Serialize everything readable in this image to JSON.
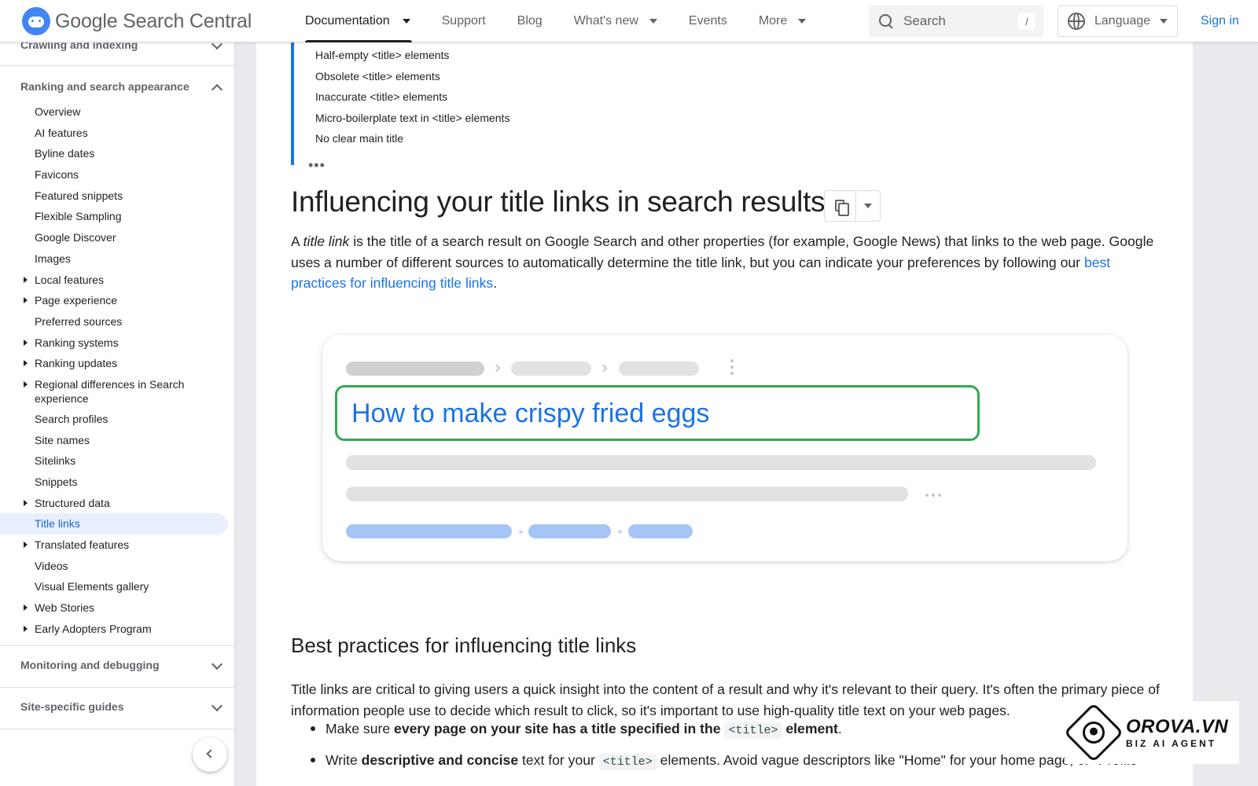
{
  "header": {
    "logo_google": "Google",
    "logo_product": "Search Central",
    "nav": [
      {
        "label": "Documentation"
      },
      {
        "label": "Support"
      },
      {
        "label": "Blog"
      },
      {
        "label": "What's new"
      },
      {
        "label": "Events"
      },
      {
        "label": "More"
      }
    ],
    "search_placeholder": "Search",
    "search_shortcut": "/",
    "language_label": "Language",
    "signin_label": "Sign in"
  },
  "sidebar": {
    "section_top": "Crawling and indexing",
    "section_ranking": "Ranking and search appearance",
    "items": [
      {
        "label": "Overview"
      },
      {
        "label": "AI features"
      },
      {
        "label": "Byline dates"
      },
      {
        "label": "Favicons"
      },
      {
        "label": "Featured snippets"
      },
      {
        "label": "Flexible Sampling"
      },
      {
        "label": "Google Discover"
      },
      {
        "label": "Images"
      },
      {
        "label": "Local features"
      },
      {
        "label": "Page experience"
      },
      {
        "label": "Preferred sources"
      },
      {
        "label": "Ranking systems"
      },
      {
        "label": "Ranking updates"
      },
      {
        "label": "Regional differences in Search experience"
      },
      {
        "label": "Search profiles"
      },
      {
        "label": "Site names"
      },
      {
        "label": "Sitelinks"
      },
      {
        "label": "Snippets"
      },
      {
        "label": "Structured data"
      },
      {
        "label": "Title links"
      },
      {
        "label": "Translated features"
      },
      {
        "label": "Videos"
      },
      {
        "label": "Visual Elements gallery"
      },
      {
        "label": "Web Stories"
      },
      {
        "label": "Early Adopters Program"
      }
    ],
    "section_monitoring": "Monitoring and debugging",
    "section_site": "Site-specific guides"
  },
  "toc": {
    "items": [
      "Half-empty <title> elements",
      "Obsolete <title> elements",
      "Inaccurate <title> elements",
      "Micro-boilerplate text in <title> elements",
      "No clear main title"
    ],
    "more": "•••"
  },
  "main": {
    "h1": "Influencing your title links in search results",
    "intro_a": "A ",
    "intro_em": "title link",
    "intro_b": " is the title of a search result on Google Search and other properties (for example, Google News) that links to the web page. Google uses a number of different sources to automatically determine the title link, but you can indicate your preferences by following our ",
    "intro_link": "best practices for influencing title links",
    "intro_end": ".",
    "illustration_title": "How to make crispy fried eggs",
    "h2": "Best practices for influencing title links",
    "para2": "Title links are critical to giving users a quick insight into the content of a result and why it's relevant to their query. It's often the primary piece of information people use to decide which result to click, so it's important to use high-quality title text on your web pages.",
    "bullet1_a": "Make sure ",
    "bullet1_b": "every page on your site has a title specified in the",
    "bullet1_code": "<title>",
    "bullet1_c": "element",
    "bullet1_d": ".",
    "bullet2_a": "Write ",
    "bullet2_b": "descriptive and concise",
    "bullet2_c": " text for your ",
    "bullet2_code": "<title>",
    "bullet2_d": " elements. Avoid vague descriptors like \"Home\" for your home page, or \"Profile\""
  },
  "watermark": {
    "title": "OROVA.VN",
    "subtitle": "BIZ AI AGENT"
  }
}
